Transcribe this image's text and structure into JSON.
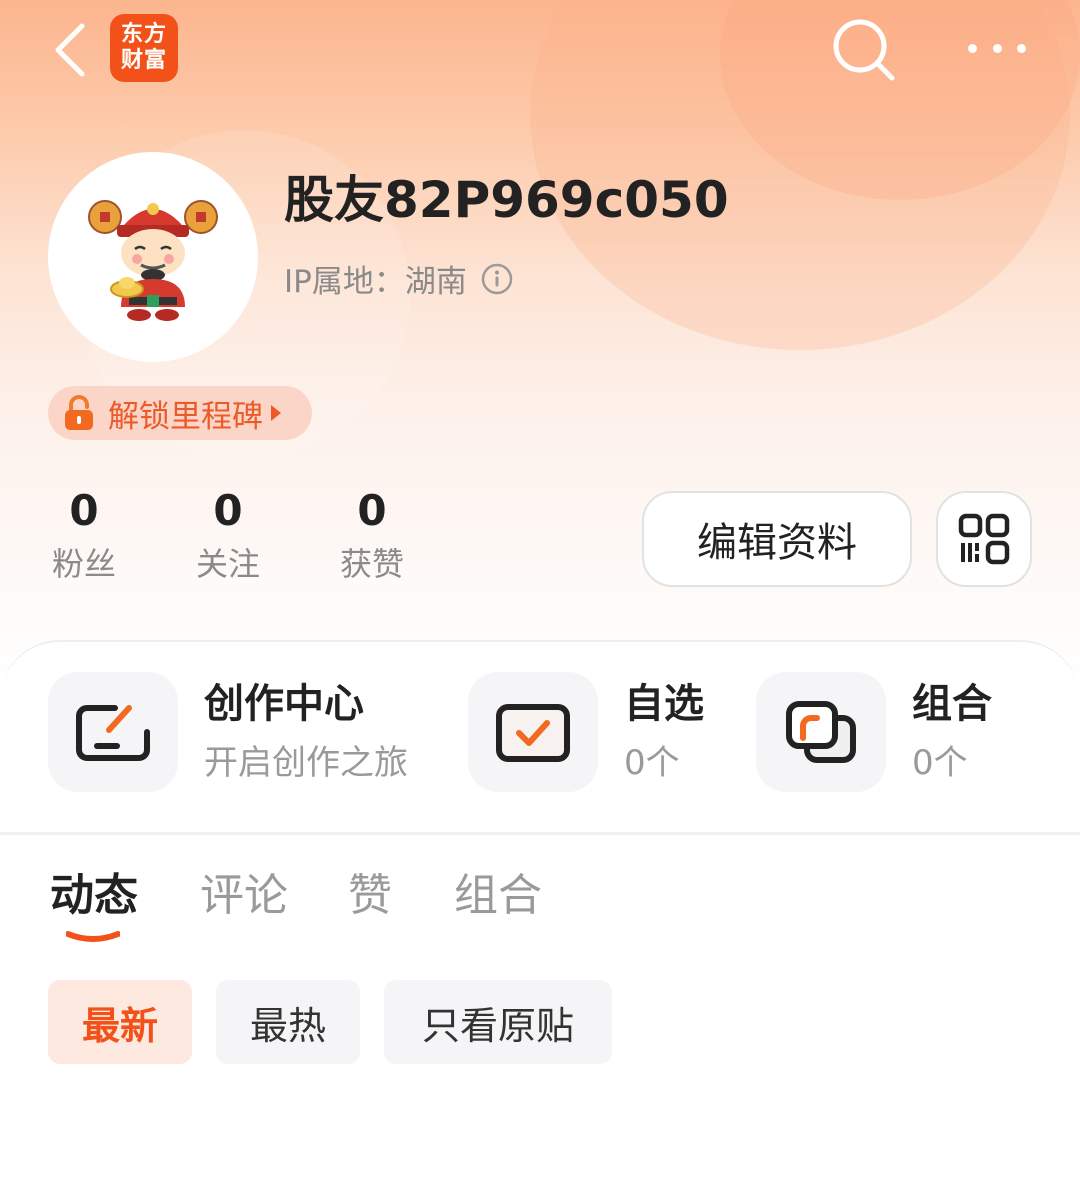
{
  "app": {
    "logo_line1": "东方",
    "logo_line2": "财富",
    "brand_color": "#f2521a"
  },
  "header": {
    "back_icon": "chevron-left-icon",
    "search_icon": "search-icon",
    "more_icon": "more-dots-icon"
  },
  "profile": {
    "username": "股友82P969c050",
    "ip_location": "IP属地：湖南",
    "avatar": "caishen-cartoon-avatar",
    "milestone_label": "解锁里程碑"
  },
  "stats": [
    {
      "value": "0",
      "label": "粉丝"
    },
    {
      "value": "0",
      "label": "关注"
    },
    {
      "value": "0",
      "label": "获赞"
    }
  ],
  "actions": {
    "edit_profile": "编辑资料",
    "qr_icon": "qr-code-icon"
  },
  "features": [
    {
      "title": "创作中心",
      "subtitle": "开启创作之旅",
      "icon": "create-icon"
    },
    {
      "title": "自选",
      "subtitle": "0个",
      "icon": "watchlist-check-icon"
    },
    {
      "title": "组合",
      "subtitle": "0个",
      "icon": "portfolio-icon"
    }
  ],
  "tabs": [
    "动态",
    "评论",
    "赞",
    "组合"
  ],
  "active_tab": "动态",
  "filters": [
    "最新",
    "最热",
    "只看原贴"
  ],
  "active_filter": "最新"
}
